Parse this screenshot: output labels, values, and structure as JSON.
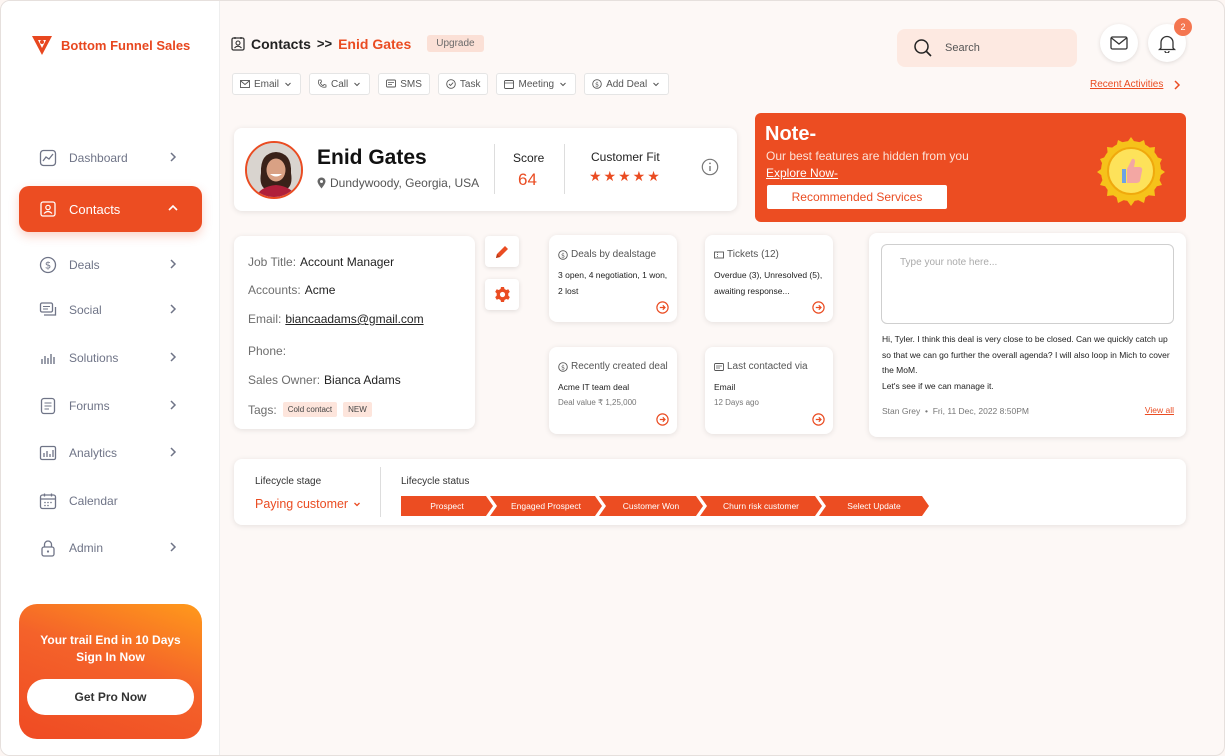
{
  "app": {
    "brand": "Bottom Funnel Sales"
  },
  "sidebar": {
    "items": [
      {
        "label": "Dashboard",
        "icon": "chart-box-icon"
      },
      {
        "label": "Contacts",
        "icon": "contacts-icon",
        "active": true
      },
      {
        "label": "Deals",
        "icon": "dollar-circle-icon"
      },
      {
        "label": "Social",
        "icon": "chat-icon"
      },
      {
        "label": "Solutions",
        "icon": "bar-chart-icon"
      },
      {
        "label": "Forums",
        "icon": "document-icon"
      },
      {
        "label": "Analytics",
        "icon": "analytics-icon"
      },
      {
        "label": "Calendar",
        "icon": "calendar-icon"
      },
      {
        "label": "Admin",
        "icon": "lock-icon"
      }
    ],
    "promo": {
      "line1": "Your trail End in 10 Days",
      "line2": "Sign In Now",
      "button": "Get Pro Now"
    }
  },
  "header": {
    "crumb_root": "Contacts",
    "crumb_sep": ">>",
    "crumb_current": "Enid Gates",
    "upgrade": "Upgrade",
    "search_placeholder": "Search",
    "notification_count": "2"
  },
  "toolbar": {
    "items": [
      "Email",
      "Call",
      "SMS",
      "Task",
      "Meeting",
      "Add Deal"
    ],
    "recent_activities": "Recent Activities"
  },
  "profile": {
    "name": "Enid Gates",
    "location": "Dundywoody, Georgia, USA",
    "score_label": "Score",
    "score": "64",
    "fit_label": "Customer Fit",
    "fit_stars": 5,
    "stars_text": "★★★★★"
  },
  "note_banner": {
    "title": "Note-",
    "subtitle": "Our best features are hidden from you",
    "link": "Explore Now-",
    "button": "Recommended Services"
  },
  "details": {
    "job_title_label": "Job Title:",
    "job_title": "Account Manager",
    "accounts_label": "Accounts:",
    "accounts": "Acme",
    "email_label": "Email:",
    "email": "biancaadams@gmail.com",
    "phone_label": "Phone:",
    "phone": "",
    "owner_label": "Sales Owner:",
    "owner": "Bianca Adams",
    "tags_label": "Tags:",
    "tags": [
      "Cold contact",
      "NEW"
    ]
  },
  "widgets": {
    "deals": {
      "title": "Deals by dealstage",
      "body": "3 open, 4 negotiation, 1 won, 2 lost"
    },
    "tickets": {
      "title": "Tickets (12)",
      "body": "Overdue (3), Unresolved (5), awaiting response..."
    },
    "recent_deal": {
      "title": "Recently created deal",
      "body": "Acme IT team deal",
      "small": "Deal value ₹ 1,25,000"
    },
    "last_contact": {
      "title": "Last contacted via",
      "body": "Email",
      "small": "12 Days ago"
    }
  },
  "notes": {
    "placeholder": "Type your note here...",
    "message1": "Hi, Tyler. I think this deal is very close to be closed. Can we quickly catch up so that we can go further the overall agenda? I will also loop in Mich to cover the MoM.",
    "message2": "Let's see if we can manage it.",
    "author": "Stan Grey",
    "date": "Fri, 11 Dec, 2022  8:50PM",
    "view_all": "View all"
  },
  "lifecycle": {
    "stage_label": "Lifecycle stage",
    "stage_value": "Paying customer",
    "status_label": "Lifecycle status",
    "steps": [
      "Prospect",
      "Engaged Prospect",
      "Customer Won",
      "Churn risk customer",
      "Select Update"
    ]
  },
  "colors": {
    "accent": "#ec4d22",
    "accent_light": "#fde9e1"
  }
}
